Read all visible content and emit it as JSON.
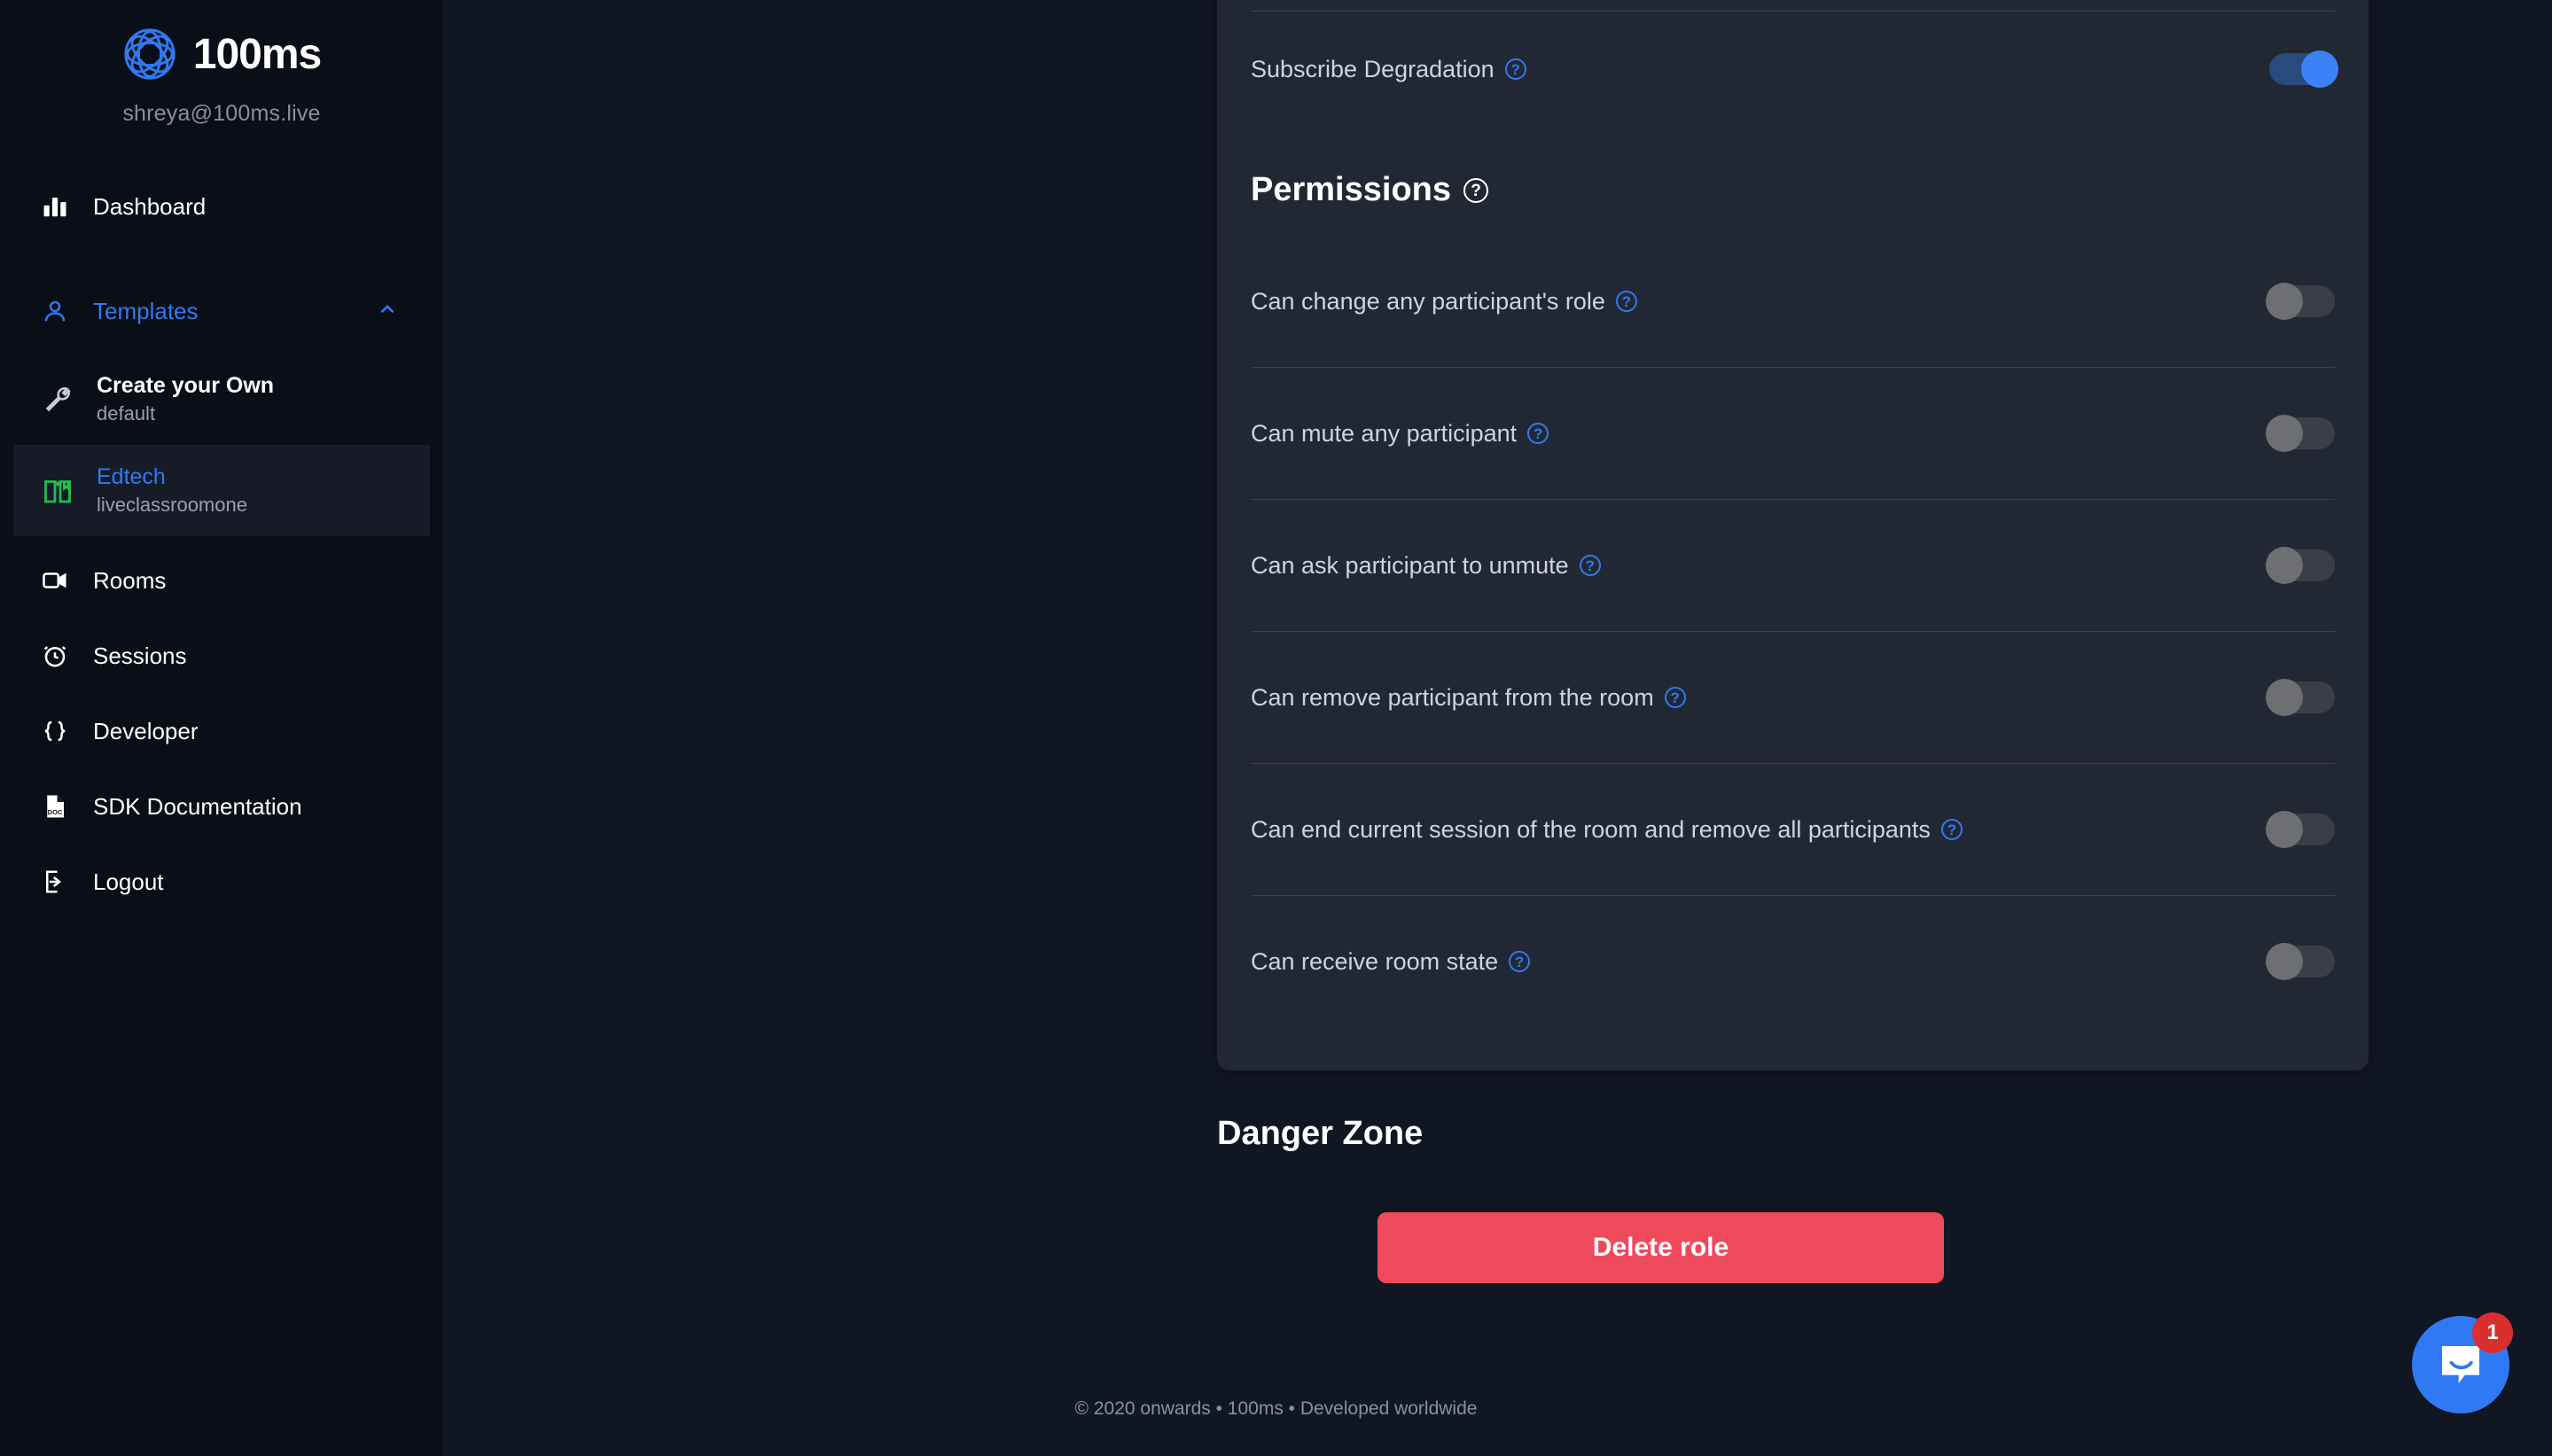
{
  "brand": {
    "name": "100ms",
    "email": "shreya@100ms.live",
    "logo_icon": "100ms-flower-logo",
    "accent_color": "#2f7af4"
  },
  "sidebar": {
    "items": [
      {
        "label": "Dashboard",
        "icon": "bar-chart-icon",
        "accent": false
      },
      {
        "label": "Templates",
        "icon": "user-icon",
        "accent": true,
        "chevron": "chevron-up-icon"
      },
      {
        "label": "Rooms",
        "icon": "video-camera-icon",
        "accent": false
      },
      {
        "label": "Sessions",
        "icon": "alarm-clock-icon",
        "accent": false
      },
      {
        "label": "Developer",
        "icon": "code-braces-icon",
        "accent": false
      },
      {
        "label": "SDK Documentation",
        "icon": "doc-file-icon",
        "accent": false
      },
      {
        "label": "Logout",
        "icon": "logout-arrow-icon",
        "accent": false
      }
    ],
    "templates": [
      {
        "title": "Create your Own",
        "subtitle": "default",
        "icon": "wrench-icon",
        "active": false
      },
      {
        "title": "Edtech",
        "subtitle": "liveclassroomone",
        "icon": "open-book-icon",
        "active": true
      }
    ]
  },
  "settings": {
    "subscribe_degradation": {
      "label": "Subscribe Degradation",
      "help": "?",
      "enabled": true
    }
  },
  "permissions": {
    "heading": "Permissions",
    "heading_help": "?",
    "rows": [
      {
        "label": "Can change any participant's role",
        "help": "?",
        "enabled": false
      },
      {
        "label": "Can mute any participant",
        "help": "?",
        "enabled": false
      },
      {
        "label": "Can ask participant to unmute",
        "help": "?",
        "enabled": false
      },
      {
        "label": "Can remove participant from the room",
        "help": "?",
        "enabled": false
      },
      {
        "label": "Can end current session of the room and remove all participants",
        "help": "?",
        "enabled": false
      },
      {
        "label": "Can receive room state",
        "help": "?",
        "enabled": false
      }
    ]
  },
  "danger_zone": {
    "title": "Danger Zone",
    "delete_label": "Delete role",
    "delete_color": "#ef4a5c"
  },
  "footer": {
    "text": "© 2020 onwards • 100ms • Developed worldwide"
  },
  "intercom": {
    "badge_count": "1",
    "badge_color": "#da2f2f",
    "launcher_color": "#2f7af4"
  }
}
